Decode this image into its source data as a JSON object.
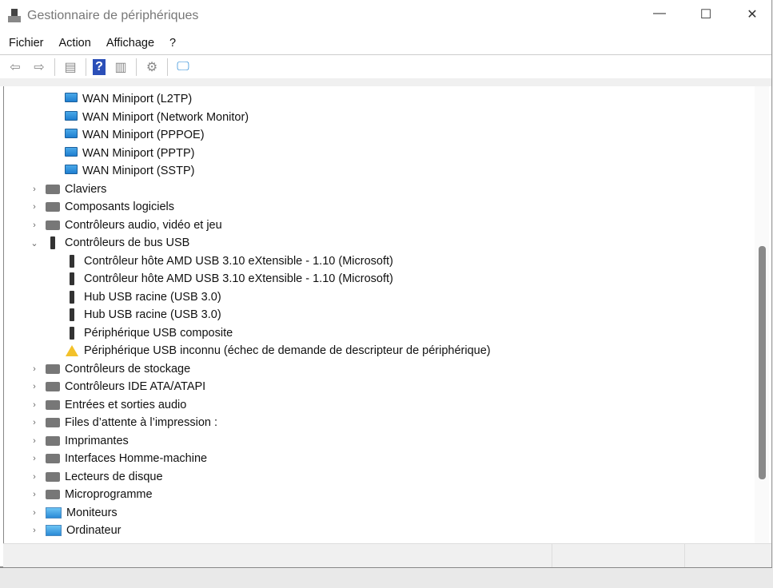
{
  "window": {
    "title": "Gestionnaire de périphériques",
    "minimize": "—",
    "maximize": "☐",
    "close": "✕"
  },
  "menu": [
    "Fichier",
    "Action",
    "Affichage",
    "?"
  ],
  "toolbar": [
    {
      "icon": "back-icon",
      "glyph": "⇦"
    },
    {
      "icon": "forward-icon",
      "glyph": "⇨"
    },
    {
      "icon": "show-hide-console-tree-icon",
      "glyph": "▤"
    },
    {
      "icon": "help-icon",
      "glyph": "?"
    },
    {
      "icon": "show-action-pane-icon",
      "glyph": "▥"
    },
    {
      "icon": "update-driver-icon",
      "glyph": "⚙"
    },
    {
      "icon": "scan-hardware-icon",
      "glyph": "🖵"
    }
  ],
  "tree": [
    {
      "label": "WAN Miniport (L2TP)",
      "level": 2,
      "icon": "network"
    },
    {
      "label": "WAN Miniport (Network Monitor)",
      "level": 2,
      "icon": "network"
    },
    {
      "label": "WAN Miniport (PPPOE)",
      "level": 2,
      "icon": "network"
    },
    {
      "label": "WAN Miniport (PPTP)",
      "level": 2,
      "icon": "network"
    },
    {
      "label": "WAN Miniport (SSTP)",
      "level": 2,
      "icon": "network"
    },
    {
      "label": "Claviers",
      "level": 1,
      "icon": "generic",
      "chevron": "›"
    },
    {
      "label": "Composants logiciels",
      "level": 1,
      "icon": "generic",
      "chevron": "›"
    },
    {
      "label": "Contrôleurs audio, vidéo et jeu",
      "level": 1,
      "icon": "generic",
      "chevron": "›"
    },
    {
      "label": "Contrôleurs de bus USB",
      "level": 1,
      "icon": "usb",
      "chevron": "⌄"
    },
    {
      "label": "Contrôleur hôte AMD USB 3.10 eXtensible - 1.10 (Microsoft)",
      "level": 2,
      "icon": "usb"
    },
    {
      "label": "Contrôleur hôte AMD USB 3.10 eXtensible - 1.10 (Microsoft)",
      "level": 2,
      "icon": "usb"
    },
    {
      "label": "Hub USB racine (USB 3.0)",
      "level": 2,
      "icon": "usb"
    },
    {
      "label": "Hub USB racine (USB 3.0)",
      "level": 2,
      "icon": "usb"
    },
    {
      "label": "Périphérique USB composite",
      "level": 2,
      "icon": "usb"
    },
    {
      "label": "Périphérique USB inconnu (échec de demande de descripteur de périphérique)",
      "level": 2,
      "icon": "warning"
    },
    {
      "label": "Contrôleurs de stockage",
      "level": 1,
      "icon": "generic",
      "chevron": "›"
    },
    {
      "label": "Contrôleurs IDE ATA/ATAPI",
      "level": 1,
      "icon": "generic",
      "chevron": "›"
    },
    {
      "label": "Entrées et sorties audio",
      "level": 1,
      "icon": "generic",
      "chevron": "›"
    },
    {
      "label": "Files d’attente à l’impression :",
      "level": 1,
      "icon": "generic",
      "chevron": "›"
    },
    {
      "label": "Imprimantes",
      "level": 1,
      "icon": "generic",
      "chevron": "›"
    },
    {
      "label": "Interfaces Homme-machine",
      "level": 1,
      "icon": "generic",
      "chevron": "›"
    },
    {
      "label": "Lecteurs de disque",
      "level": 1,
      "icon": "generic",
      "chevron": "›"
    },
    {
      "label": "Microprogramme",
      "level": 1,
      "icon": "generic",
      "chevron": "›"
    },
    {
      "label": "Moniteurs",
      "level": 1,
      "icon": "monitor",
      "chevron": "›"
    },
    {
      "label": "Ordinateur",
      "level": 1,
      "icon": "monitor",
      "chevron": "›"
    }
  ]
}
